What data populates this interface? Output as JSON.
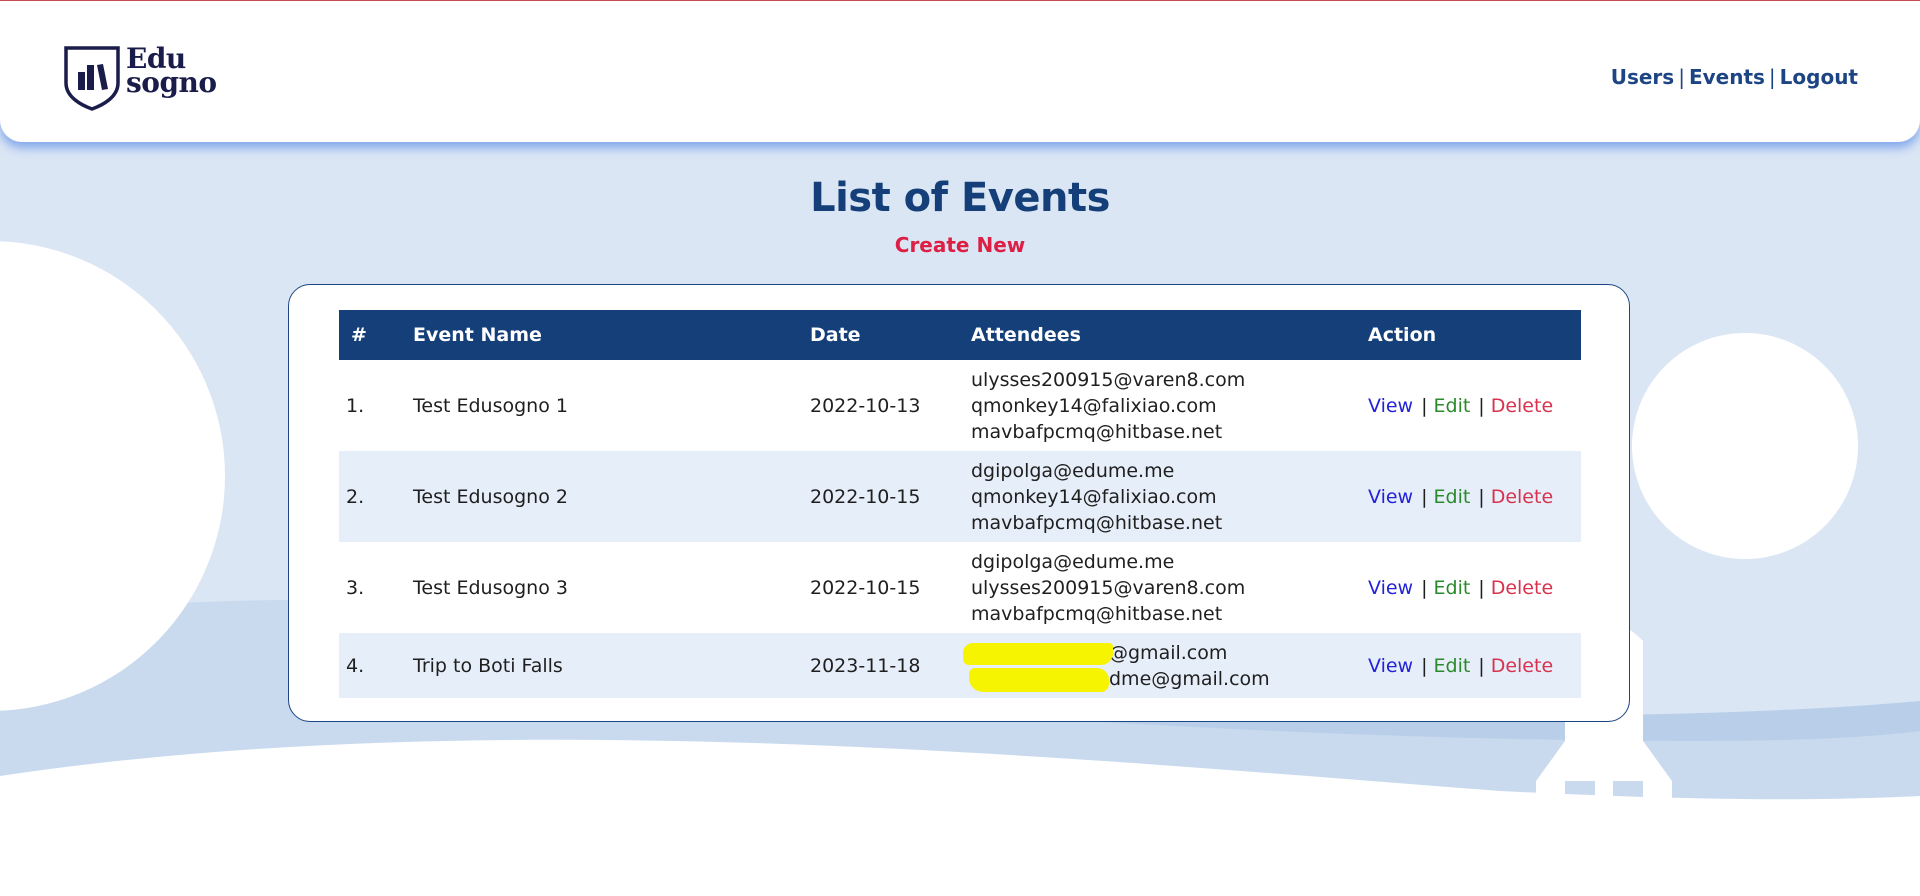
{
  "brand": {
    "logo_line1": "Edu",
    "logo_line2": "sogno"
  },
  "nav": {
    "users": "Users",
    "events": "Events",
    "logout": "Logout",
    "separator": "|"
  },
  "page": {
    "title": "List of Events",
    "create_new": "Create New"
  },
  "table": {
    "headers": {
      "num": "#",
      "name": "Event Name",
      "date": "Date",
      "attendees": "Attendees",
      "action": "Action"
    },
    "actions": {
      "view": "View",
      "edit": "Edit",
      "delete": "Delete",
      "separator": "|"
    },
    "rows": [
      {
        "num": "1.",
        "name": "Test Edusogno 1",
        "date": "2022-10-13",
        "attendees": [
          "ulysses200915@varen8.com",
          "qmonkey14@falixiao.com",
          "mavbafpcmq@hitbase.net"
        ]
      },
      {
        "num": "2.",
        "name": "Test Edusogno 2",
        "date": "2022-10-15",
        "attendees": [
          "dgipolga@edume.me",
          "qmonkey14@falixiao.com",
          "mavbafpcmq@hitbase.net"
        ]
      },
      {
        "num": "3.",
        "name": "Test Edusogno 3",
        "date": "2022-10-15",
        "attendees": [
          "dgipolga@edume.me",
          "ulysses200915@varen8.com",
          "mavbafpcmq@hitbase.net"
        ]
      },
      {
        "num": "4.",
        "name": "Trip to Boti Falls",
        "date": "2023-11-18",
        "attendees": [
          "@gmail.com",
          "dme@gmail.com"
        ]
      }
    ]
  },
  "colors": {
    "primary": "#143f78",
    "accent": "#dc2045",
    "view": "#2222d8",
    "edit": "#2a8a2a",
    "delete": "#d8324e",
    "background": "#dbe6f5"
  }
}
